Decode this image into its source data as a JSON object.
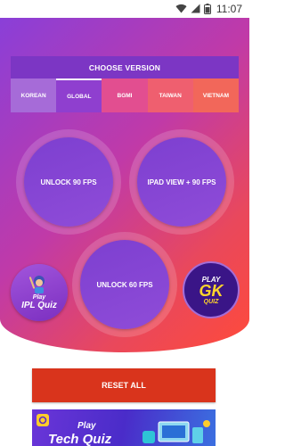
{
  "status_bar": {
    "time": "11:07",
    "icons": [
      "wifi-icon",
      "signal-icon",
      "battery-icon"
    ]
  },
  "version_selector": {
    "title": "CHOOSE VERSION",
    "options": [
      "KOREAN",
      "GLOBAL",
      "BGMI",
      "TAIWAN",
      "VIETNAM"
    ],
    "selected": "GLOBAL"
  },
  "actions": {
    "unlock_90": "UNLOCK 90 FPS",
    "ipad_view": "IPAD VIEW + 90 FPS",
    "unlock_60": "UNLOCK 60 FPS",
    "reset": "RESET ALL"
  },
  "promos": {
    "ipl": {
      "line1": "Play",
      "line2": "IPL Quiz"
    },
    "gk": {
      "line1": "PLAY",
      "line2": "GK",
      "line3": "QUIZ"
    },
    "tech": {
      "line1": "Play",
      "line2": "Tech Quiz"
    }
  },
  "colors": {
    "accent": "#7c36c4",
    "reset": "#d9341c",
    "gradient_start": "#8a3fd8",
    "gradient_end": "#ff4a3a"
  }
}
